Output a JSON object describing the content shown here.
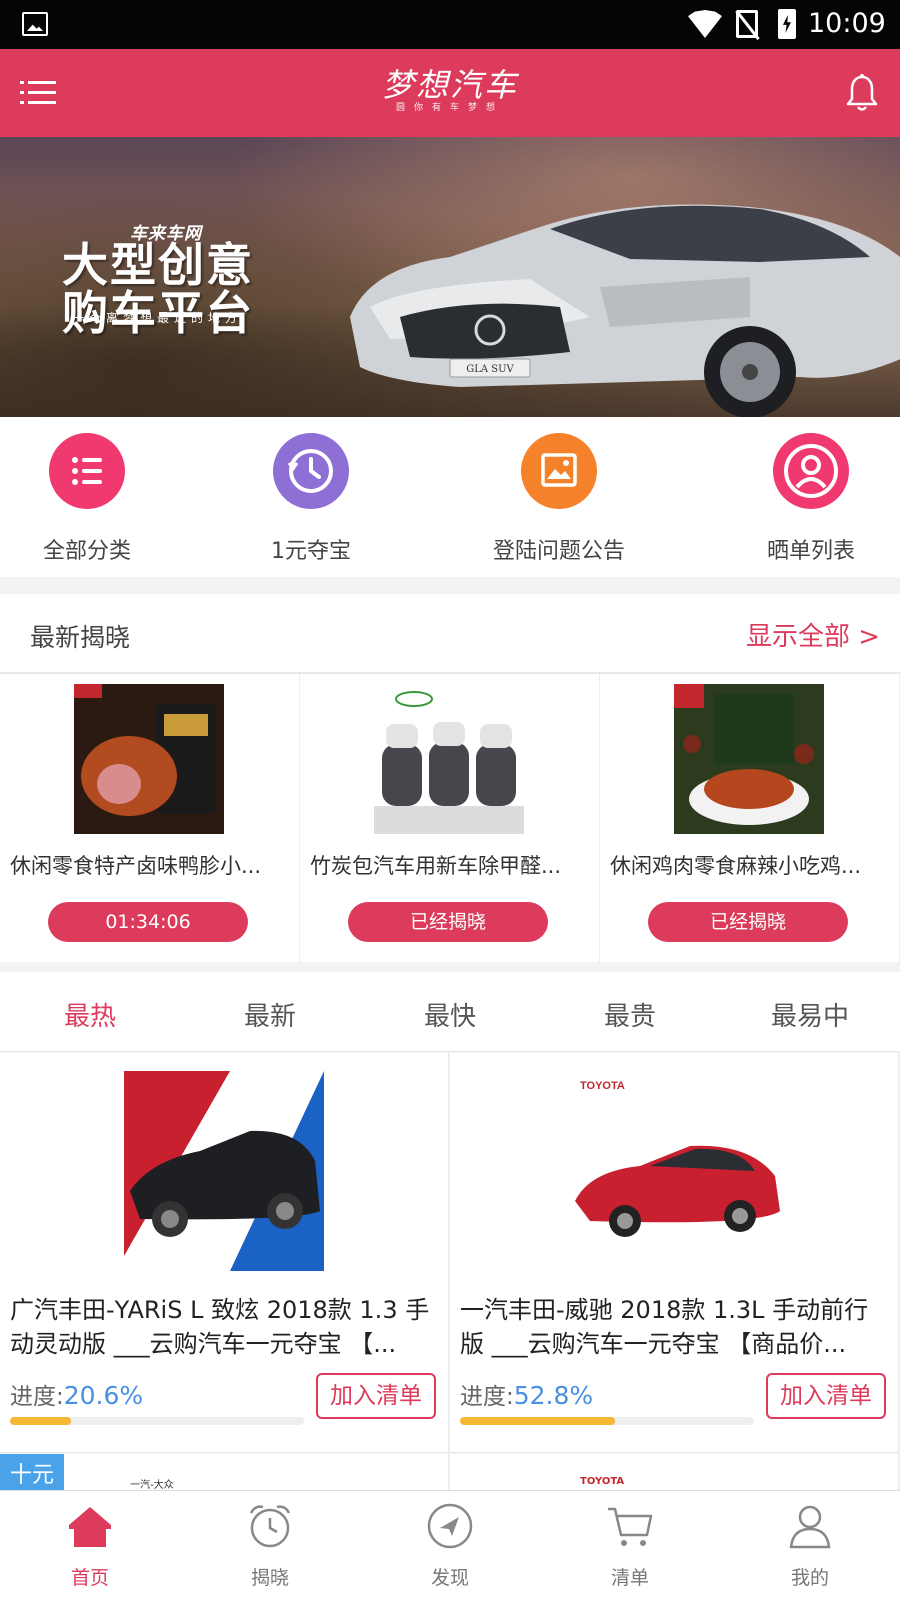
{
  "status_bar": {
    "time": "10:09"
  },
  "header": {
    "brand": "梦想汽车",
    "tagline": "圆你有车梦想"
  },
  "banner": {
    "small": "车来车网",
    "big_line1": "大型创意",
    "big_line2": "购车平台",
    "sub": "一个离梦想最近的地方",
    "plate": "GLA SUV",
    "dots_count": 3,
    "active_dot": 0
  },
  "quick_entries": [
    {
      "label": "全部分类",
      "icon": "list-icon",
      "color": "#f0396f"
    },
    {
      "label": "1元夺宝",
      "icon": "clock-icon",
      "color": "#8e6fd6"
    },
    {
      "label": "登陆问题公告",
      "icon": "image-icon",
      "color": "#f5812b"
    },
    {
      "label": "晒单列表",
      "icon": "user-icon",
      "color": "#f0396f"
    }
  ],
  "latest": {
    "title": "最新揭晓",
    "show_all": "显示全部 >",
    "items": [
      {
        "title": "休闲零食特产卤味鸭胗小...",
        "button": "01:34:06"
      },
      {
        "title": "竹炭包汽车用新车除甲醛...",
        "button": "已经揭晓"
      },
      {
        "title": "休闲鸡肉零食麻辣小吃鸡...",
        "button": "已经揭晓"
      }
    ]
  },
  "tabs": [
    "最热",
    "最新",
    "最快",
    "最贵",
    "最易中"
  ],
  "active_tab": 0,
  "products": [
    {
      "title": "广汽丰田-YARiS L 致炫  2018款 1.3 手动灵动版 ___云购汽车一元夺宝 【...",
      "progress_label": "进度:",
      "progress_text": "20.6%",
      "progress": 0.206,
      "add_label": "加入清单"
    },
    {
      "title": "一汽丰田-威驰 2018款 1.3L 手动前行版 ___云购汽车一元夺宝 【商品价...",
      "progress_label": "进度:",
      "progress_text": "52.8%",
      "progress": 0.528,
      "add_label": "加入清单"
    }
  ],
  "peek": {
    "badge": "十元",
    "left_brand": "一汽-大众",
    "right_brand": "TOYOTA"
  },
  "bottom_nav": [
    {
      "label": "首页",
      "icon": "home-icon"
    },
    {
      "label": "揭晓",
      "icon": "alarm-icon"
    },
    {
      "label": "发现",
      "icon": "compass-icon"
    },
    {
      "label": "清单",
      "icon": "cart-icon"
    },
    {
      "label": "我的",
      "icon": "person-icon"
    }
  ],
  "active_nav": 0,
  "colors": {
    "brand": "#dd3b5b",
    "progress_fill": "#f6b731",
    "progress_text": "#4a90e2",
    "badge": "#4aa3e8"
  }
}
